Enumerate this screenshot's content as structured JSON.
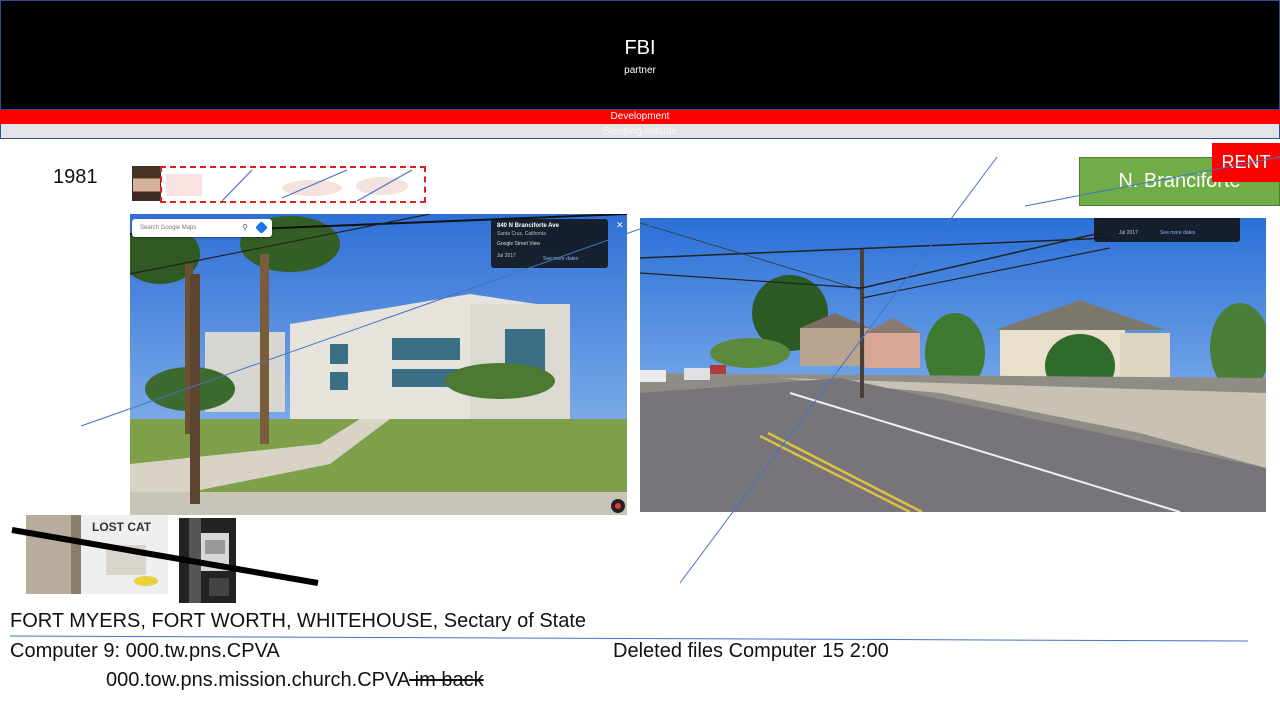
{
  "header": {
    "title": "FBI",
    "subtitle": "partner"
  },
  "bands": {
    "red": "Development",
    "grey": "Sleeping outside"
  },
  "year": "1981",
  "photo1": {
    "search_placeholder": "Search Google Maps",
    "address": "840 N Branciforte Ave",
    "city": "Santa Cruz, California",
    "street_view": "Google Street View",
    "date": "Jul 2017",
    "see_more": "See more dates"
  },
  "photo2": {
    "date": "Jul 2017",
    "see_more": "See more dates"
  },
  "callouts": {
    "green": "N. Branciforte",
    "red": "RENT"
  },
  "flyer": {
    "lost_cat": "LOST CAT"
  },
  "text": {
    "places": "FORT MYERS, FORT WORTH, WHITEHOUSE, Sectary of State",
    "computer9": "Computer 9: 000.tw.pns.CPVA",
    "deleted": "Deleted files Computer 15 2:00",
    "path2": "000.tow.pns.mission.church.CPVA",
    "path2_struck": " im back"
  },
  "colors": {
    "header_bg": "#000000",
    "band_red": "#ff0000",
    "green_box": "#70ad47",
    "rent_box": "#ff0000",
    "line_blue": "#4472c4"
  }
}
